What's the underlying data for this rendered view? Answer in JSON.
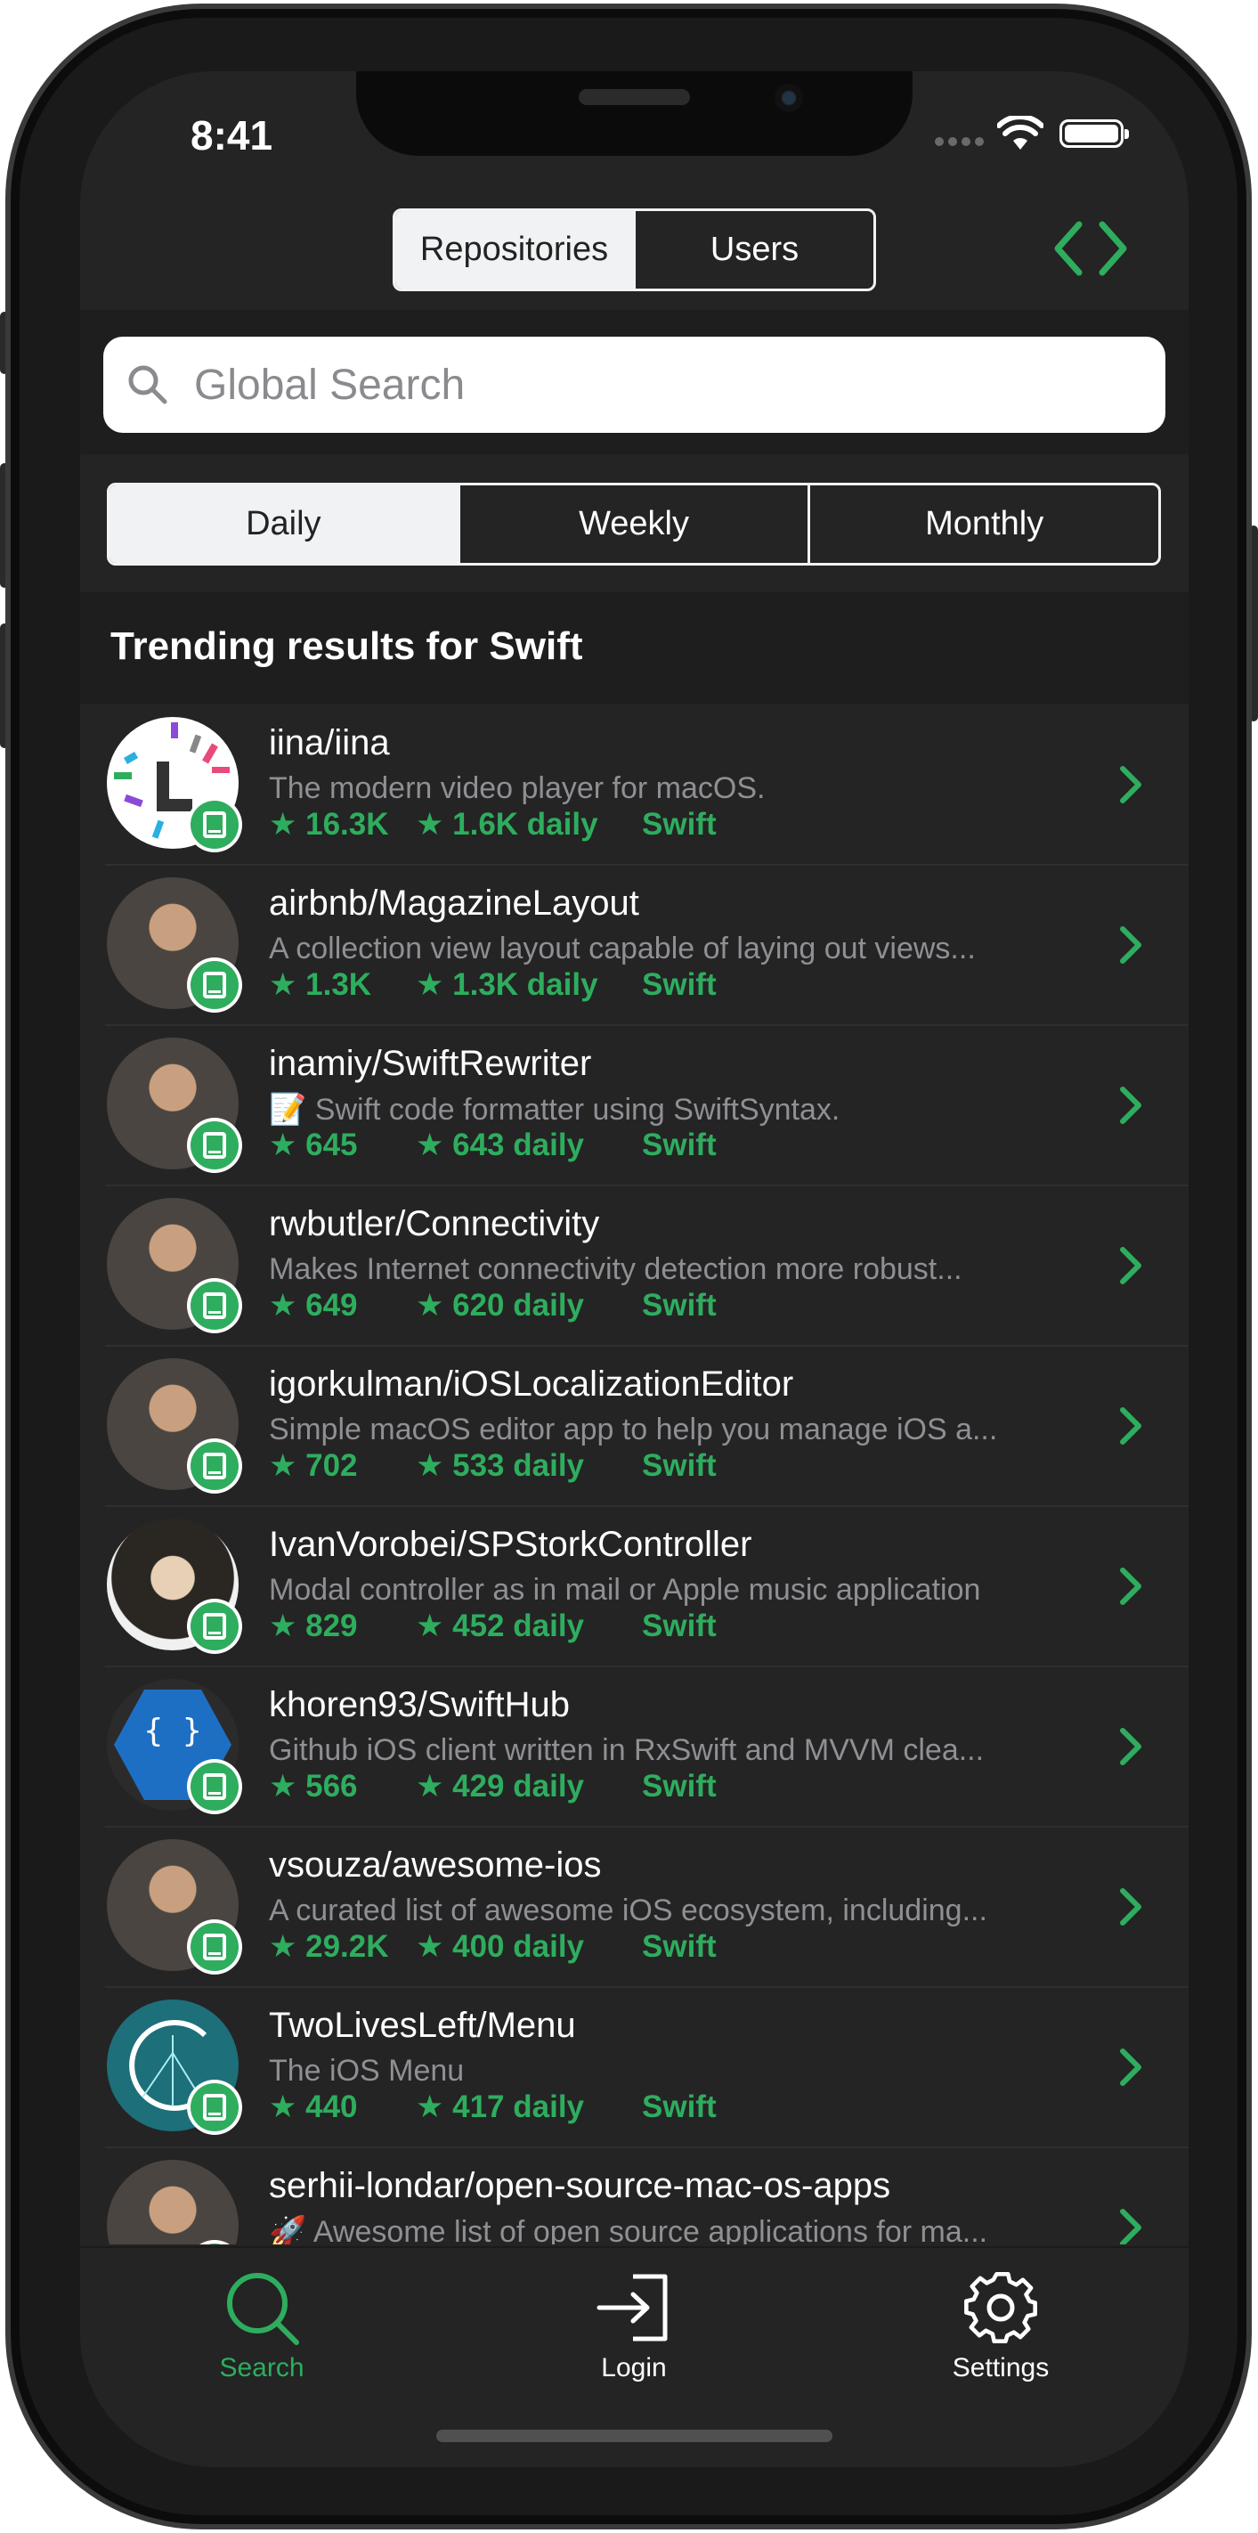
{
  "status_bar": {
    "time": "8:41"
  },
  "top_segment": {
    "options": [
      "Repositories",
      "Users"
    ],
    "selected": "Repositories"
  },
  "search": {
    "placeholder": "Global Search"
  },
  "period_segment": {
    "options": [
      "Daily",
      "Weekly",
      "Monthly"
    ],
    "selected": "Daily"
  },
  "section": {
    "title": "Trending results for Swift"
  },
  "colors": {
    "accent": "#2ead5e",
    "background": "#242424",
    "secondary_text": "#8f8f94"
  },
  "repositories": [
    {
      "name": "iina/iina",
      "description": "The modern video player for macOS.",
      "stars": "16.3K",
      "daily": "1.6K daily",
      "language": "Swift",
      "avatar": "iina-logo"
    },
    {
      "name": "airbnb/MagazineLayout",
      "description": "A collection view layout capable of laying out views...",
      "stars": "1.3K",
      "daily": "1.3K daily",
      "language": "Swift",
      "avatar": "user-photo"
    },
    {
      "name": "inamiy/SwiftRewriter",
      "description": "📝 Swift code formatter using SwiftSyntax.",
      "stars": "645",
      "daily": "643 daily",
      "language": "Swift",
      "avatar": "user-photo"
    },
    {
      "name": "rwbutler/Connectivity",
      "description": "Makes Internet connectivity detection more robust...",
      "stars": "649",
      "daily": "620 daily",
      "language": "Swift",
      "avatar": "user-photo"
    },
    {
      "name": "igorkulman/iOSLocalizationEditor",
      "description": "Simple macOS editor app to help you manage iOS a...",
      "stars": "702",
      "daily": "533 daily",
      "language": "Swift",
      "avatar": "user-photo"
    },
    {
      "name": "IvanVorobei/SPStorkController",
      "description": "Modal controller as in mail or Apple music application",
      "stars": "829",
      "daily": "452 daily",
      "language": "Swift",
      "avatar": "user-illustration"
    },
    {
      "name": "khoren93/SwiftHub",
      "description": "Github iOS client written in RxSwift and MVVM clea...",
      "stars": "566",
      "daily": "429 daily",
      "language": "Swift",
      "avatar": "developer-logo"
    },
    {
      "name": "vsouza/awesome-ios",
      "description": "A curated list of awesome iOS ecosystem, including...",
      "stars": "29.2K",
      "daily": "400 daily",
      "language": "Swift",
      "avatar": "user-photo"
    },
    {
      "name": "TwoLivesLeft/Menu",
      "description": "The iOS Menu",
      "stars": "440",
      "daily": "417 daily",
      "language": "Swift",
      "avatar": "c-logo"
    },
    {
      "name": "serhii-londar/open-source-mac-os-apps",
      "description": "🚀 Awesome list of open source applications for ma...",
      "stars": "",
      "daily": "",
      "language": "",
      "avatar": "user-photo"
    }
  ],
  "tab_bar": {
    "items": [
      {
        "label": "Search",
        "icon": "search-icon",
        "active": true
      },
      {
        "label": "Login",
        "icon": "login-icon",
        "active": false
      },
      {
        "label": "Settings",
        "icon": "gear-icon",
        "active": false
      }
    ]
  }
}
